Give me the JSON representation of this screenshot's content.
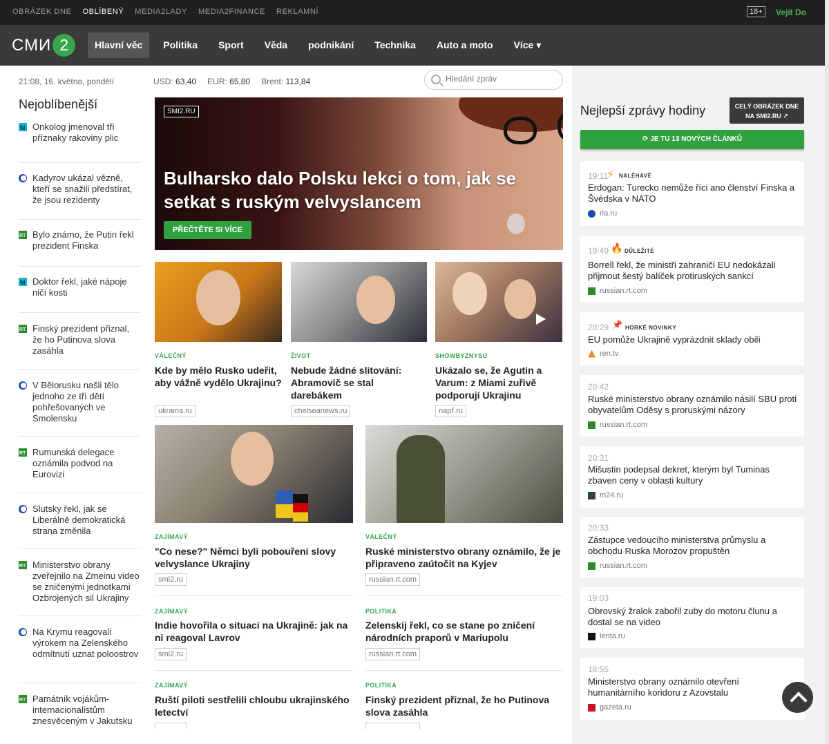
{
  "topbar": {
    "links": [
      "OBRÁZEK DNE",
      "OBLÍBENÝ",
      "MEDIA2LADY",
      "MEDIA2FINANCE",
      "REKLAMNÍ"
    ],
    "active_index": 1,
    "age": "18+",
    "login": "Vejít Do"
  },
  "nav": {
    "logo_text": "СМИ",
    "logo_num": "2",
    "items": [
      "Hlavní věc",
      "Politika",
      "Sport",
      "Věda",
      "podnikání",
      "Technika",
      "Auto a moto",
      "Více"
    ]
  },
  "header": {
    "datetime": "21:08, 16. května, pondělí",
    "usd_label": "USD:",
    "usd": "63,40",
    "eur_label": "EUR:",
    "eur": "65,80",
    "brent_label": "Brent:",
    "brent": "113,84",
    "search_placeholder": "Hledání zpráv"
  },
  "left": {
    "title": "Nejoblíbenější",
    "items": [
      {
        "text": "Onkolog jmenoval tři příznaky rakoviny plic",
        "src": "m24"
      },
      {
        "text": "Kadyrov ukázal vězně, kteří se snažili předstírat, že jsou rezidenty",
        "src": "ria"
      },
      {
        "text": "Bylo známo, že Putin řekl prezident Finska",
        "src": "rt"
      },
      {
        "text": "Doktor řekl, jaké nápoje ničí kosti",
        "src": "m24"
      },
      {
        "text": "Finský prezident přiznal, že ho Putinova slova zasáhla",
        "src": "rt"
      },
      {
        "text": "V Bělorusku našli tělo jednoho ze tří dětí pohřešovaných ve Smolensku",
        "src": "ria"
      },
      {
        "text": "Rumunská delegace oznámila podvod na Eurovizi",
        "src": "rt"
      },
      {
        "text": "Slutsky řekl, jak se Liberálně demokratická strana změnila",
        "src": "ria"
      },
      {
        "text": "Ministerstvo obrany zveřejnilo na Zmeinu video se zničenými jednotkami Ozbrojených sil Ukrajiny",
        "src": "rt"
      },
      {
        "text": "Na Krymu reagovali výrokem na Zelenského odmítnutí uznat poloostrov",
        "src": "ria"
      },
      {
        "text": "Památník vojákům-internacionalistům znesvěceným v Jakutsku",
        "src": "rt"
      }
    ]
  },
  "hero": {
    "badge": "SMI2.RU",
    "title": "Bulharsko dalo Polsku lekci o tom, jak se setkat s ruským velvyslancem",
    "button": "PŘEČTĚTE SI VÍCE"
  },
  "cards": [
    {
      "cat": "VÁLEČNÝ",
      "title": "Kde by mělo Rusko udeřit, aby vážně vydělo Ukrajinu?",
      "src": "ukraina.ru"
    },
    {
      "cat": "ŽIVOT",
      "title": "Nebude žádné slitování: Abramovič se stal darebákem",
      "src": "chelseanews.ru"
    },
    {
      "cat": "SHOWBYZNYSU",
      "title": "Ukázalo se, že Agutin a Varum: z Miami zuřivě podporují Ukrajinu",
      "src": "např.ru"
    },
    {
      "cat": "ZAJÍMAVÝ",
      "title": "\"Co nese?\" Němci byli pobouřeni slovy velvyslance Ukrajiny",
      "src": "smi2.ru"
    },
    {
      "cat": "VÁLEČNÝ",
      "title": "Ruské ministerstvo obrany oznámilo, že je připraveno zaútočit na Kyjev",
      "src": "russian.rt.com"
    }
  ],
  "textnews": [
    {
      "cat": "ZAJÍMAVÝ",
      "title": "Indie hovořila o situaci na Ukrajině: jak na ni reagoval Lavrov",
      "src": "smi2.ru"
    },
    {
      "cat": "POLITIKA",
      "title": "Zelenskij řekl, co se stane po zničení národních praporů v Mariupolu",
      "src": "russian.rt.com"
    },
    {
      "cat": "ZAJÍMAVÝ",
      "title": "Ruští piloti sestřelili chloubu ukrajinského letectví",
      "src": ""
    },
    {
      "cat": "POLITIKA",
      "title": "Finský prezident přiznal, že ho Putinova slova zasáhla",
      "src": ""
    }
  ],
  "right": {
    "title": "Nejlepší zprávy hodiny",
    "btn_line1": "CELÝ OBRÁZEK DNE",
    "btn_line2": "NA SMI2.RU ↗",
    "green": "⟳ JE TU 13 NOVÝCH ČLÁNKŮ",
    "items": [
      {
        "time": "19:11",
        "tag": "NALÉHAVÉ",
        "title": "Erdogan: Turecko nemůže říci ano členství Finska a Švédska v NATO",
        "src": "ria.ru",
        "ic": "ria"
      },
      {
        "time": "19:49",
        "tag": "DŮLEŽITÉ",
        "title": "Borrell řekl, že ministři zahraničí EU nedokázali přijmout šestý balíček protiruských sankcí",
        "src": "russian.rt.com",
        "ic": "rt"
      },
      {
        "time": "20:29",
        "tag": "HORKÉ NOVINKY",
        "title": "EU pomůže Ukrajině vyprázdnit sklady obilí",
        "src": "ren.tv",
        "ic": "ren"
      },
      {
        "time": "20:42",
        "tag": "",
        "title": "Ruské ministerstvo obrany oznámilo násilí SBU proti obyvatelům Oděsy s proruskými názory",
        "src": "russian.rt.com",
        "ic": "rt"
      },
      {
        "time": "20:31",
        "tag": "",
        "title": "Mišustin podepsal dekret, kterým byl Tuminas zbaven ceny v oblasti kultury",
        "src": "m24.ru",
        "ic": "m24"
      },
      {
        "time": "20:33",
        "tag": "",
        "title": "Zástupce vedoucího ministerstva průmyslu a obchodu Ruska Morozov propuštěn",
        "src": "russian.rt.com",
        "ic": "rt"
      },
      {
        "time": "19:03",
        "tag": "",
        "title": "Obrovský žralok zabořil zuby do motoru člunu a dostal se na video",
        "src": "lenta.ru",
        "ic": "lenta"
      },
      {
        "time": "18:55",
        "tag": "",
        "title": "Ministerstvo obrany oznámilo otevření humanitárního koridoru z Azovstalu",
        "src": "gazeta.ru",
        "ic": "gazeta"
      }
    ]
  }
}
